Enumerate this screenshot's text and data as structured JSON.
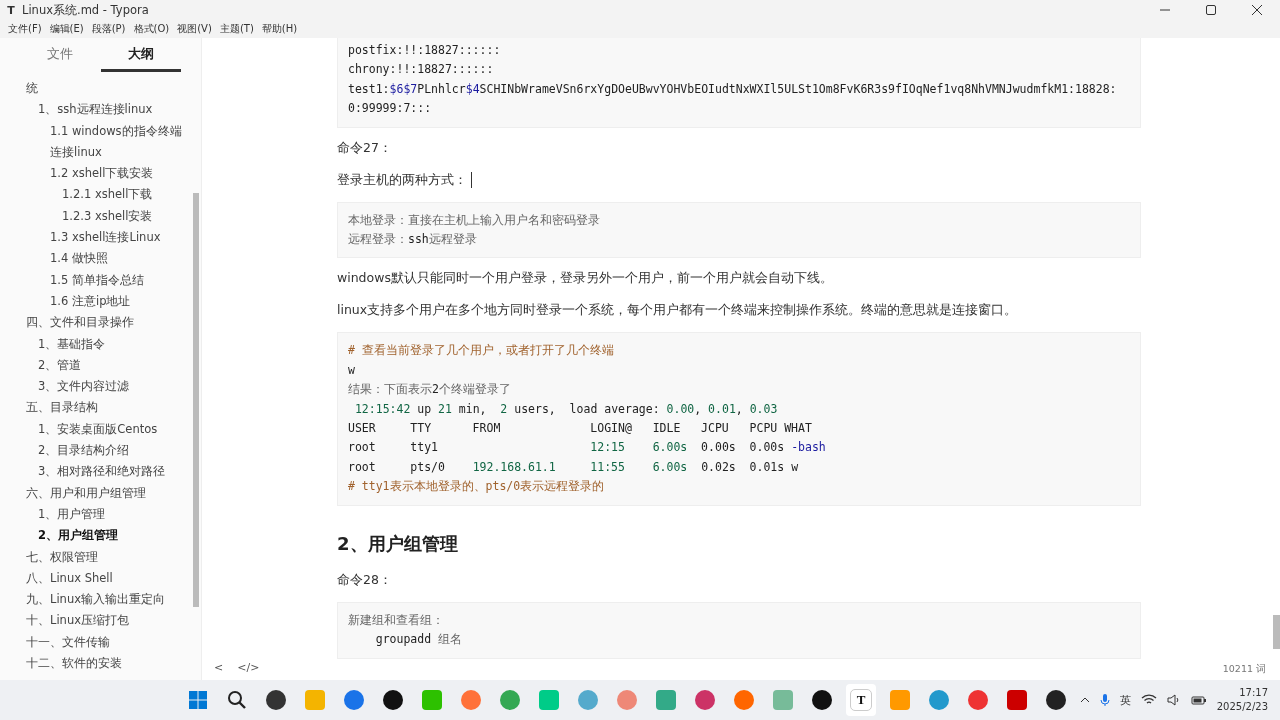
{
  "window": {
    "icon_letter": "T",
    "title": "Linux系统.md - Typora"
  },
  "menu": [
    "文件(F)",
    "编辑(E)",
    "段落(P)",
    "格式(O)",
    "视图(V)",
    "主题(T)",
    "帮助(H)"
  ],
  "sidebar": {
    "tabs": [
      {
        "label": "文件",
        "selected": false
      },
      {
        "label": "大纲",
        "selected": true
      }
    ],
    "outline": [
      {
        "label": "统",
        "selected": false,
        "children": [
          {
            "label": "1、ssh远程连接linux",
            "selected": false,
            "children": [
              {
                "label": "1.1 windows的指令终端连接linux",
                "selected": false
              },
              {
                "label": "1.2 xshell下载安装",
                "selected": false,
                "children": [
                  {
                    "label": "1.2.1 xshell下载",
                    "selected": false
                  },
                  {
                    "label": "1.2.3 xshell安装",
                    "selected": false
                  }
                ]
              },
              {
                "label": "1.3 xshell连接Linux",
                "selected": false
              },
              {
                "label": "1.4 做快照",
                "selected": false
              },
              {
                "label": "1.5 简单指令总结",
                "selected": false
              },
              {
                "label": "1.6 注意ip地址",
                "selected": false
              }
            ]
          }
        ]
      },
      {
        "label": "四、文件和目录操作",
        "selected": false,
        "children": [
          {
            "label": "1、基础指令",
            "selected": false
          },
          {
            "label": "2、管道",
            "selected": false
          },
          {
            "label": "3、文件内容过滤",
            "selected": false
          }
        ]
      },
      {
        "label": "五、目录结构",
        "selected": false,
        "children": [
          {
            "label": "1、安装桌面版Centos",
            "selected": false
          },
          {
            "label": "2、目录结构介绍",
            "selected": false
          },
          {
            "label": "3、相对路径和绝对路径",
            "selected": false
          }
        ]
      },
      {
        "label": "六、用户和用户组管理",
        "selected": false,
        "children": [
          {
            "label": "1、用户管理",
            "selected": false
          },
          {
            "label": "2、用户组管理",
            "selected": true
          }
        ]
      },
      {
        "label": "七、权限管理",
        "selected": false
      },
      {
        "label": "八、Linux Shell",
        "selected": false
      },
      {
        "label": "九、Linux输入输出重定向",
        "selected": false
      },
      {
        "label": "十、Linux压缩打包",
        "selected": false
      },
      {
        "label": "十一、文件传输",
        "selected": false
      },
      {
        "label": "十二、软件的安装",
        "selected": false
      }
    ],
    "footer": [
      "<",
      "</>"
    ]
  },
  "document": [
    {
      "kind": "code",
      "lines": [
        [
          {
            "kind": "plain",
            "text": "postfix:!!:18827::::::"
          }
        ],
        [
          {
            "kind": "plain",
            "text": "chrony:!!:18827::::::"
          }
        ],
        [
          {
            "kind": "plain",
            "text": "test1:"
          },
          {
            "kind": "variable",
            "text": "$6$7"
          },
          {
            "kind": "plain",
            "text": "PLnhlcr"
          },
          {
            "kind": "variable",
            "text": "$4"
          },
          {
            "kind": "plain",
            "text": "SCHINbWrameVSn6rxYgDOeUBwvYOHVbEOIudtNxWXIl5ULSt1Om8FvK6R3s9fIOqNef1vq8NhVMNJwudmfkM1:18828:0:99999:7:::"
          }
        ]
      ]
    },
    {
      "kind": "para",
      "text": "命令27："
    },
    {
      "kind": "para",
      "text": "登录主机的两种方式：",
      "cursor": true
    },
    {
      "kind": "code",
      "lines": [
        [
          {
            "kind": "note",
            "text": "本地登录：直接在主机上输入用户名和密码登录"
          }
        ],
        [
          {
            "kind": "note",
            "text": "远程登录："
          },
          {
            "kind": "plain",
            "text": "ssh"
          },
          {
            "kind": "note",
            "text": "远程登录"
          }
        ]
      ]
    },
    {
      "kind": "para",
      "text": "windows默认只能同时一个用户登录，登录另外一个用户，前一个用户就会自动下线。"
    },
    {
      "kind": "para",
      "text": "linux支持多个用户在多个地方同时登录一个系统，每个用户都有一个终端来控制操作系统。终端的意思就是连接窗口。"
    },
    {
      "kind": "code",
      "lines": [
        [
          {
            "kind": "comment",
            "text": "# 查看当前登录了几个用户，或者打开了几个终端"
          }
        ],
        [
          {
            "kind": "plain",
            "text": "w"
          }
        ],
        [
          {
            "kind": "note",
            "text": "结果：下面表示"
          },
          {
            "kind": "plain",
            "text": "2"
          },
          {
            "kind": "note",
            "text": "个终端登录了"
          }
        ],
        [
          {
            "kind": "number",
            "text": " 12:15:42"
          },
          {
            "kind": "plain",
            "text": " up "
          },
          {
            "kind": "number",
            "text": "21"
          },
          {
            "kind": "plain",
            "text": " min,  "
          },
          {
            "kind": "number",
            "text": "2"
          },
          {
            "kind": "plain",
            "text": " users,  load average: "
          },
          {
            "kind": "number",
            "text": "0.00"
          },
          {
            "kind": "plain",
            "text": ", "
          },
          {
            "kind": "number",
            "text": "0.01"
          },
          {
            "kind": "plain",
            "text": ", "
          },
          {
            "kind": "number",
            "text": "0.03"
          }
        ],
        [
          {
            "kind": "plain",
            "text": "USER     TTY      FROM             LOGIN@   IDLE   JCPU   PCPU WHAT"
          }
        ],
        [
          {
            "kind": "plain",
            "text": "root     tty1                      "
          },
          {
            "kind": "number",
            "text": "12:15"
          },
          {
            "kind": "number",
            "text": "    6.00s"
          },
          {
            "kind": "plain",
            "text": "  0.00s  0.00s "
          },
          {
            "kind": "variable",
            "text": "-bash"
          }
        ],
        [
          {
            "kind": "plain",
            "text": "root     pts/0    "
          },
          {
            "kind": "number",
            "text": "192.168.61.1"
          },
          {
            "kind": "number",
            "text": "     11:55"
          },
          {
            "kind": "number",
            "text": "    6.00s"
          },
          {
            "kind": "plain",
            "text": "  0.02s  0.01s w"
          }
        ],
        [
          {
            "kind": "comment",
            "text": "# tty1表示本地登录的、pts/0表示远程登录的"
          }
        ]
      ]
    },
    {
      "kind": "heading",
      "text": "2、用户组管理"
    },
    {
      "kind": "para",
      "text": "命令28："
    },
    {
      "kind": "code",
      "lines": [
        [
          {
            "kind": "note",
            "text": "新建组和查看组："
          }
        ],
        [
          {
            "kind": "plain",
            "text": "    groupadd "
          },
          {
            "kind": "note",
            "text": "组名"
          }
        ]
      ]
    }
  ],
  "word_count": "10211 词",
  "taskbar": {
    "apps": [
      {
        "selected": false
      },
      {
        "selected": false
      },
      {
        "selected": false
      },
      {
        "selected": false
      },
      {
        "selected": false
      },
      {
        "selected": false
      },
      {
        "selected": false
      },
      {
        "selected": false
      },
      {
        "selected": false
      },
      {
        "selected": false
      },
      {
        "selected": false
      },
      {
        "selected": false
      },
      {
        "selected": false
      },
      {
        "selected": false
      },
      {
        "selected": false
      },
      {
        "selected": false
      },
      {
        "selected": false
      },
      {
        "selected": true,
        "letter": "T"
      },
      {
        "selected": false
      },
      {
        "selected": false
      },
      {
        "selected": false
      },
      {
        "selected": false
      },
      {
        "selected": false
      }
    ],
    "ime": "英",
    "time": "17:17",
    "date": "2025/2/23"
  }
}
